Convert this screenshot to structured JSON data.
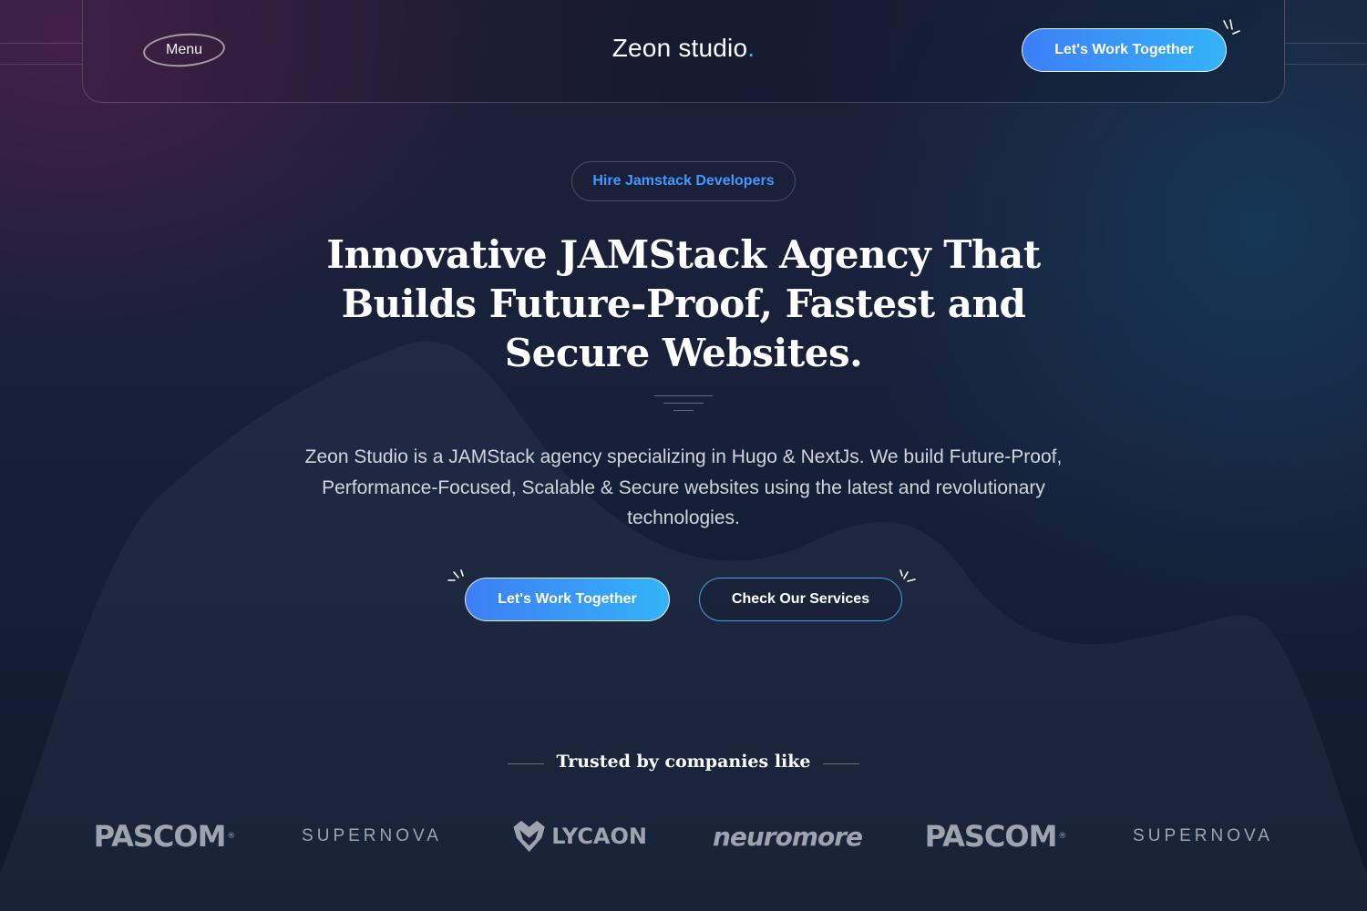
{
  "header": {
    "menu_label": "Menu",
    "logo_text": "Zeon studio",
    "logo_dot": ".",
    "cta_label": "Let's Work Together"
  },
  "hero": {
    "badge": "Hire Jamstack Developers",
    "headline_line1": "Innovative JAMStack Agency That",
    "headline_line2": "Builds Future-Proof, Fastest and",
    "headline_line3": "Secure Websites.",
    "description": "Zeon Studio is a JAMStack agency specializing in Hugo & NextJs. We build Future-Proof, Performance-Focused, Scalable & Secure websites using the latest and revolutionary technologies.",
    "primary_cta": "Let's Work Together",
    "secondary_cta": "Check Our Services"
  },
  "trusted": {
    "title": "Trusted by companies like",
    "logos": [
      "PASCOM",
      "SUPERNOVA",
      "LYCAON",
      "neuromore",
      "PASCOM",
      "SUPERNOVA"
    ]
  },
  "colors": {
    "accent_blue": "#3d7ef6",
    "accent_cyan": "#34b3f7",
    "badge_text": "#3f9bff",
    "logo_dot": "#22b8ff"
  }
}
